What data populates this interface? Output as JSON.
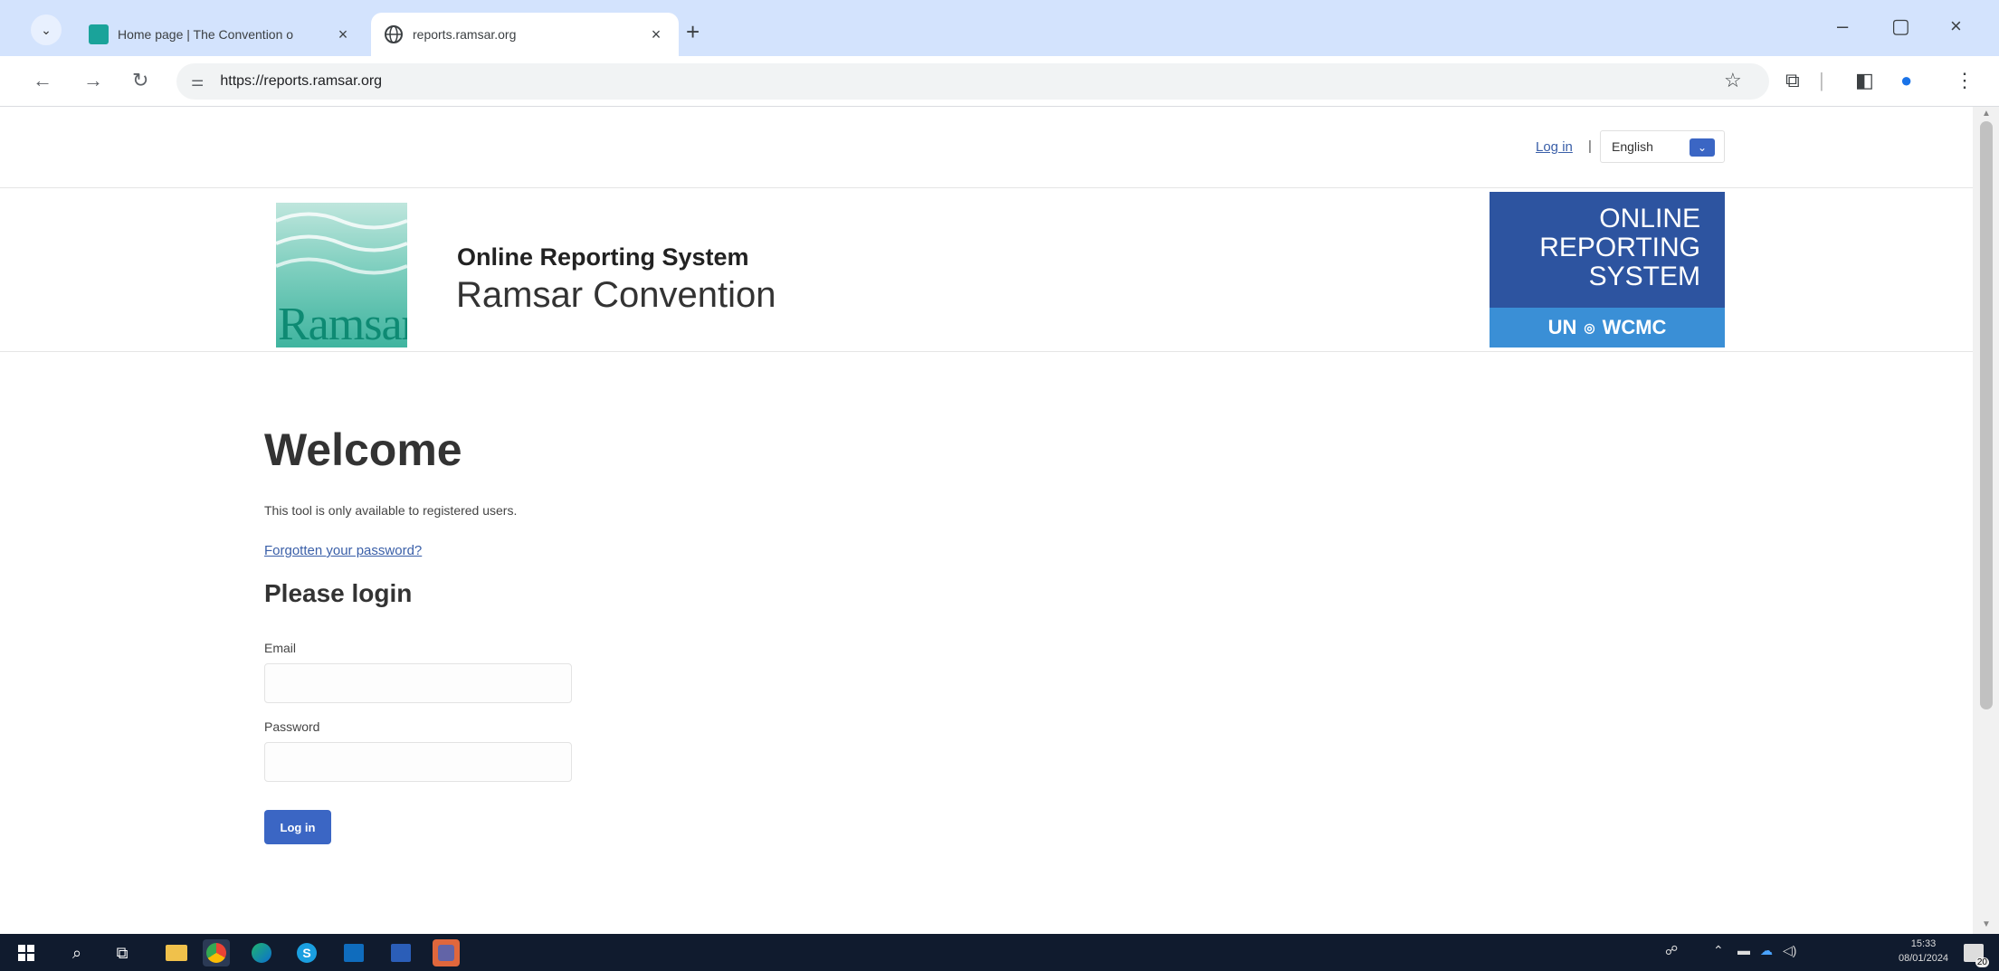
{
  "browser": {
    "tabs": [
      {
        "title": "Home page | The Convention o",
        "favicon_color": "#1aa39a"
      },
      {
        "title": "reports.ramsar.org",
        "favicon": "globe-icon"
      }
    ],
    "url": "https://reports.ramsar.org"
  },
  "page": {
    "login_link": "Log in",
    "separator": "|",
    "language": "English",
    "header": {
      "logo_text": "Ramsar",
      "system_title": "Online Reporting System",
      "system_subtitle": "Ramsar Convention",
      "ors_logo": {
        "line1": "ONLINE",
        "line2": "REPORTING",
        "line3": "SYSTEM",
        "band_left": "UN",
        "band_right": "WCMC"
      }
    },
    "welcome": "Welcome",
    "intro": "This tool is only available to registered users.",
    "forgot_link": "Forgotten your password?",
    "login_heading": "Please login",
    "email_label": "Email",
    "password_label": "Password",
    "login_button": "Log in"
  },
  "taskbar": {
    "time": "15:33",
    "date": "08/01/2024",
    "notification_count": "20"
  },
  "colors": {
    "tabbar": "#d3e3fd",
    "accent": "#3b66c4",
    "link": "#3a5fa8",
    "ors_blue": "#2d54a0",
    "taskbar": "#101b2e"
  }
}
